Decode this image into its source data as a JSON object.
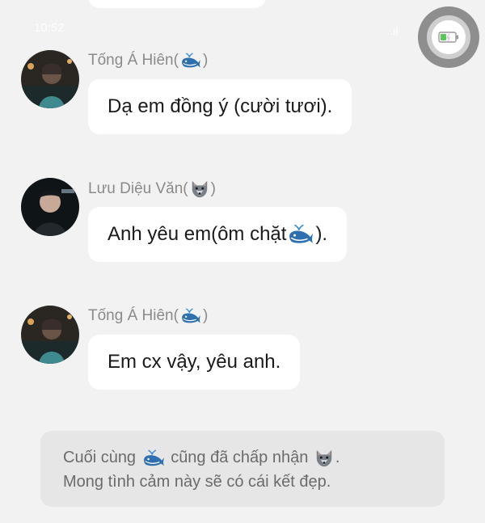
{
  "status_bar": {
    "time": "10:52",
    "signal": "..ıl"
  },
  "messages": [
    {
      "sender_name": "Tống Á Hiên",
      "sender_emoji": "whale-emoji",
      "avatar": "avatar-tong-a-hien",
      "text_before": "Dạ em đồng ý (cười tươi).",
      "text_emoji": null,
      "text_after": ""
    },
    {
      "sender_name": "Lưu Diệu Văn",
      "sender_emoji": "wolf-emoji",
      "avatar": "avatar-luu-dieu-van",
      "text_before": "Anh yêu em(ôm chặt ",
      "text_emoji": "whale-emoji",
      "text_after": ")."
    },
    {
      "sender_name": "Tống Á Hiên",
      "sender_emoji": "whale-emoji",
      "avatar": "avatar-tong-a-hien",
      "text_before": "Em cx vậy, yêu anh.",
      "text_emoji": null,
      "text_after": ""
    }
  ],
  "notice": {
    "line1_part1": "Cuối cùng",
    "line1_emoji1": "whale-emoji",
    "line1_part2": "cũng đã chấp nhận",
    "line1_emoji2": "wolf-emoji",
    "line1_part3": ".",
    "line2": "Mong tình cảm này sẽ có cái kết đẹp."
  },
  "colors": {
    "background": "#f2f2f2",
    "bubble": "#ffffff",
    "sender_name": "#8a8a8a",
    "notice_bg": "#e6e6e6",
    "whale": "#2e6fb0",
    "battery_green": "#5cc85c"
  }
}
